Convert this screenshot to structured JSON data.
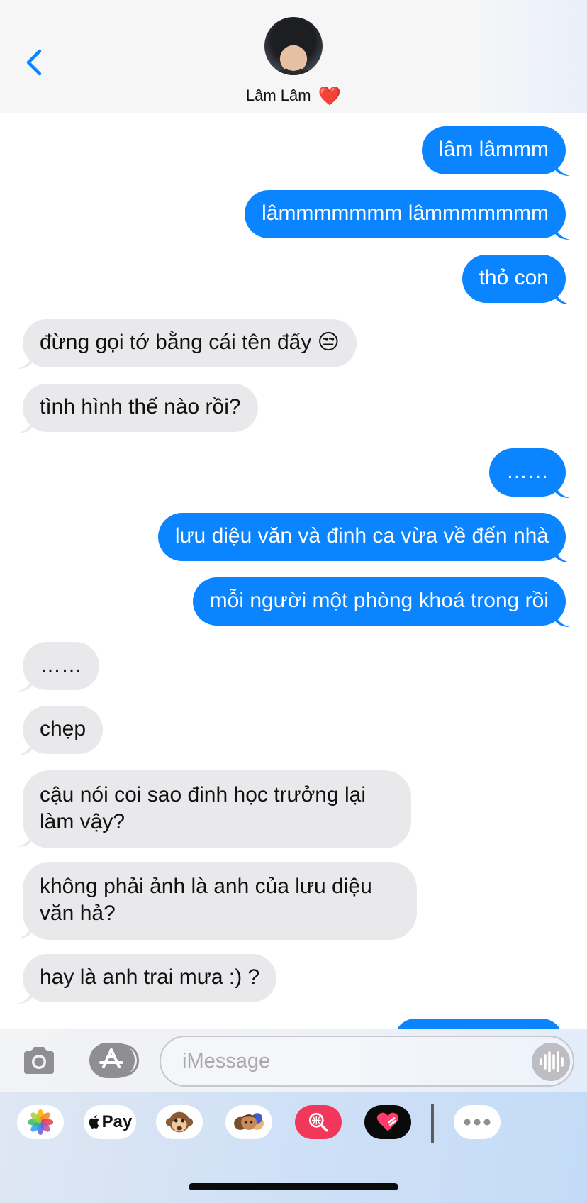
{
  "header": {
    "contact_name": "Lâm Lâm",
    "contact_emoji": "❤️"
  },
  "messages": [
    {
      "dir": "out",
      "text": "lâm lâmmm"
    },
    {
      "dir": "out",
      "text": "lâmmmmmmm lâmmmmmmm"
    },
    {
      "dir": "out",
      "text": "thỏ con"
    },
    {
      "dir": "in",
      "text": "đừng gọi tớ bằng cái tên đấy 😒"
    },
    {
      "dir": "in",
      "text": "tình hình thế nào rồi?"
    },
    {
      "dir": "out",
      "text": "……"
    },
    {
      "dir": "out",
      "text": "lưu diệu văn và đinh ca vừa về đến nhà"
    },
    {
      "dir": "out",
      "text": "mỗi người một phòng khoá trong rồi"
    },
    {
      "dir": "in",
      "text": "……"
    },
    {
      "dir": "in",
      "text": "chẹp"
    },
    {
      "dir": "in",
      "text": "cậu nói coi sao đinh học trưởng lại làm vậy?"
    },
    {
      "dir": "in",
      "text": "không phải ảnh là anh của lưu diệu văn hả?"
    },
    {
      "dir": "in",
      "text": "hay là anh trai mưa :) ?"
    }
  ],
  "input": {
    "placeholder": "iMessage",
    "value": ""
  },
  "drawer": {
    "apple_pay_label": "Pay",
    "apps": [
      "photos-icon",
      "apple-pay-icon",
      "monkey-memoji-icon",
      "memoji-group-icon",
      "web-search-icon",
      "digital-touch-icon",
      "more-icon"
    ]
  },
  "colors": {
    "outgoing": "#0a84ff",
    "incoming": "#e9e9eb",
    "accent": "#0a84ff"
  }
}
